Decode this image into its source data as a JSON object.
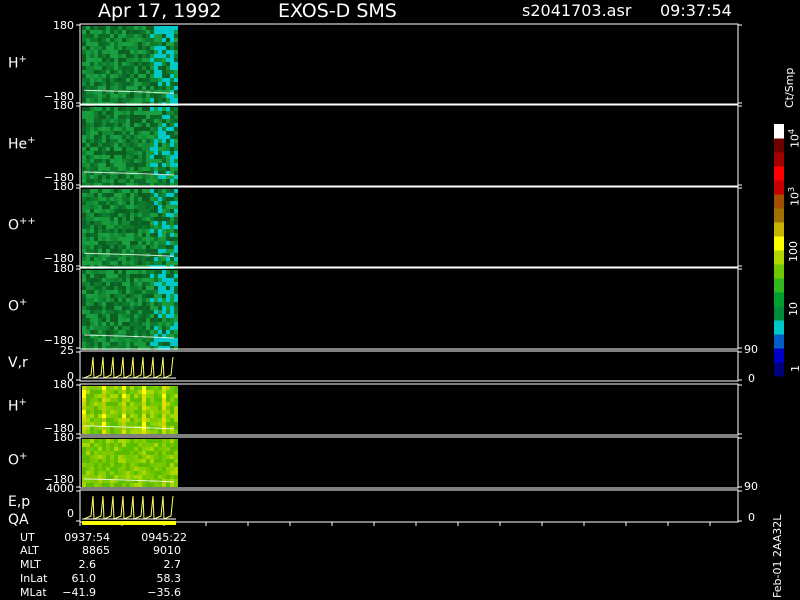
{
  "header": {
    "date": "Apr 17, 1992",
    "instrument": "EXOS-D SMS",
    "file": "s2041703.asr",
    "time": "09:37:54"
  },
  "colorbar": {
    "unit_label": "Ct/Smp",
    "tick_labels": [
      "1",
      "10",
      "100",
      "10",
      "10",
      "10"
    ],
    "tick_exponents": [
      "",
      "",
      "",
      "3",
      "4",
      ""
    ]
  },
  "side_label": "Feb-01 2AA32L",
  "chart_data": {
    "type": "heatmap",
    "x_range_ut": [
      "0937:54",
      "0945:22"
    ],
    "panels": [
      {
        "label": "H",
        "superscript": "+",
        "ylim": [
          -180,
          180
        ],
        "y_tick_top": "180",
        "y_tick_bottom": "−180",
        "kind": "spectrogram"
      },
      {
        "label": "He",
        "superscript": "+",
        "ylim": [
          -180,
          180
        ],
        "y_tick_top": "180",
        "y_tick_bottom": "−180",
        "kind": "spectrogram"
      },
      {
        "label": "O",
        "superscript": "++",
        "ylim": [
          -180,
          180
        ],
        "y_tick_top": "180",
        "y_tick_bottom": "−180",
        "kind": "spectrogram"
      },
      {
        "label": "O",
        "superscript": "+",
        "ylim": [
          -180,
          180
        ],
        "y_tick_top": "180",
        "y_tick_bottom": "−180",
        "kind": "spectrogram"
      },
      {
        "label": "V,r",
        "superscript": "",
        "ylim": [
          0,
          25
        ],
        "y_tick_top": "25",
        "y_tick_bottom": "0",
        "right_tick_top": "90",
        "right_tick_bottom": "0",
        "kind": "line"
      },
      {
        "label": "H",
        "superscript": "+",
        "ylim": [
          -180,
          180
        ],
        "y_tick_top": "180",
        "y_tick_bottom": "−180",
        "kind": "spectrogram"
      },
      {
        "label": "O",
        "superscript": "+",
        "ylim": [
          -180,
          180
        ],
        "y_tick_top": "180",
        "y_tick_bottom": "−180",
        "kind": "spectrogram"
      },
      {
        "label": "E,p",
        "label2": "QA",
        "superscript": "",
        "ylim": [
          0,
          4000
        ],
        "y_tick_top": "4000",
        "y_tick_bottom": "0",
        "right_tick_top": "90",
        "right_tick_bottom": "0",
        "kind": "line"
      }
    ]
  },
  "footer": {
    "rows": [
      {
        "name": "UT",
        "v1": "0937:54",
        "v2": "0945:22"
      },
      {
        "name": "ALT",
        "v1": "8865",
        "v2": "9010"
      },
      {
        "name": "MLT",
        "v1": "2.6",
        "v2": "2.7"
      },
      {
        "name": "InLat",
        "v1": "61.0",
        "v2": "58.3"
      },
      {
        "name": "MLat",
        "v1": "−41.9",
        "v2": "−35.6"
      }
    ]
  },
  "colors": {
    "axis": "#ffffff",
    "trace": "#ffff66",
    "qa_bar": "#ffff00",
    "scale": [
      "#00007a",
      "#0000c8",
      "#0060c8",
      "#00c8c8",
      "#008a3c",
      "#00a030",
      "#30b820",
      "#70c800",
      "#b0d800",
      "#ffff00",
      "#c8b400",
      "#a07000",
      "#a05000",
      "#c80000",
      "#ff0000",
      "#a00000",
      "#700000",
      "#ffffff"
    ]
  }
}
